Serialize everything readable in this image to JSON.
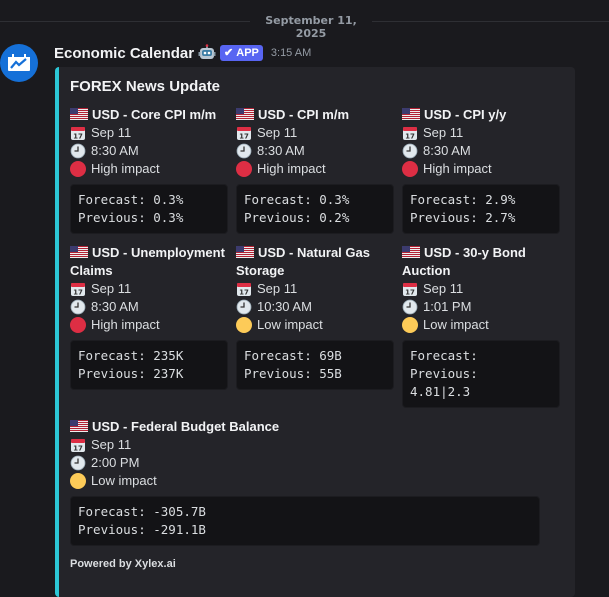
{
  "date_divider": "September 11, 2025",
  "message": {
    "username": "Economic Calendar",
    "badge": "APP",
    "timestamp": "3:15 AM"
  },
  "embed": {
    "title": "FOREX News Update",
    "accent_color": "#2cc7d6",
    "footer": "Powered by Xylex.ai",
    "events": [
      {
        "name": "USD - Core CPI m/m",
        "date": "Sep 11",
        "time": "8:30 AM",
        "impact": "High impact",
        "impact_color": "red",
        "code": "Forecast: 0.3%\nPrevious: 0.3%"
      },
      {
        "name": "USD - CPI m/m",
        "date": "Sep 11",
        "time": "8:30 AM",
        "impact": "High impact",
        "impact_color": "red",
        "code": "Forecast: 0.3%\nPrevious: 0.2%"
      },
      {
        "name": "USD - CPI y/y",
        "date": "Sep 11",
        "time": "8:30 AM",
        "impact": "High impact",
        "impact_color": "red",
        "code": "Forecast: 2.9%\nPrevious: 2.7%"
      },
      {
        "name": "USD - Unemployment Claims",
        "date": "Sep 11",
        "time": "8:30 AM",
        "impact": "High impact",
        "impact_color": "red",
        "code": "Forecast: 235K\nPrevious: 237K"
      },
      {
        "name": "USD - Natural Gas Storage",
        "date": "Sep 11",
        "time": "10:30 AM",
        "impact": "Low impact",
        "impact_color": "yellow",
        "code": "Forecast: 69B\nPrevious: 55B"
      },
      {
        "name": "USD - 30-y Bond Auction",
        "date": "Sep 11",
        "time": "1:01 PM",
        "impact": "Low impact",
        "impact_color": "yellow",
        "code": "Forecast: \nPrevious:\n4.81|2.3"
      },
      {
        "name": "USD - Federal Budget Balance",
        "date": "Sep 11",
        "time": "2:00 PM",
        "impact": "Low impact",
        "impact_color": "yellow",
        "code": "Forecast: -305.7B\nPrevious: -291.1B"
      }
    ]
  }
}
